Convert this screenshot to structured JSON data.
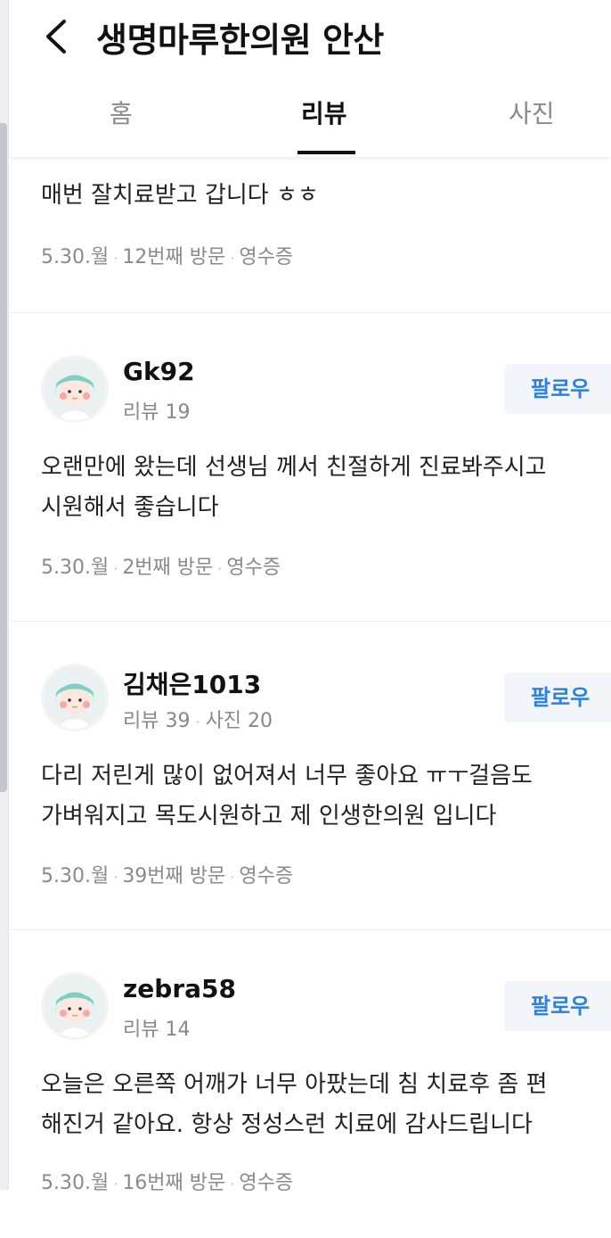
{
  "header": {
    "title": "생명마루한의원 안산",
    "back_icon": "chevron-left-icon"
  },
  "tabs": [
    {
      "label": "홈",
      "active": false
    },
    {
      "label": "리뷰",
      "active": true
    },
    {
      "label": "사진",
      "active": false
    }
  ],
  "colors": {
    "accent_blue": "#2f7fe0",
    "follow_bg": "#f2f6fb",
    "text_primary": "#222222",
    "text_secondary": "#8a8a8a"
  },
  "reviews": [
    {
      "text_lines": [
        "매번 잘치료받고 갑니다 ㅎㅎ"
      ],
      "meta": {
        "date": "5.30.월",
        "visit": "12번째 방문",
        "receipt": "영수증"
      }
    },
    {
      "nickname": "Gk92",
      "stats": [
        "리뷰 19"
      ],
      "follow_label": "팔로우",
      "text_lines": [
        "오랜만에 왔는데 선생님 께서 친절하게 진료봐주시고",
        "시원해서 좋습니다"
      ],
      "meta": {
        "date": "5.30.월",
        "visit": "2번째 방문",
        "receipt": "영수증"
      }
    },
    {
      "nickname": "김채은1013",
      "stats": [
        "리뷰 39",
        "사진 20"
      ],
      "follow_label": "팔로우",
      "text_lines": [
        "다리 저린게 많이 없어져서 너무 좋아요 ㅠㅜ걸음도",
        "가벼워지고 목도시원하고 제 인생한의원 입니다"
      ],
      "meta": {
        "date": "5.30.월",
        "visit": "39번째 방문",
        "receipt": "영수증"
      }
    },
    {
      "nickname": "zebra58",
      "stats": [
        "리뷰 14"
      ],
      "follow_label": "팔로우",
      "text_lines": [
        "오늘은 오른쪽 어깨가 너무 아팠는데 침 치료후 좀 편",
        "해진거 같아요. 항상 정성스런 치료에 감사드립니다"
      ],
      "meta": {
        "date": "5.30.월",
        "visit": "16번째 방문",
        "receipt": "영수증"
      }
    }
  ]
}
